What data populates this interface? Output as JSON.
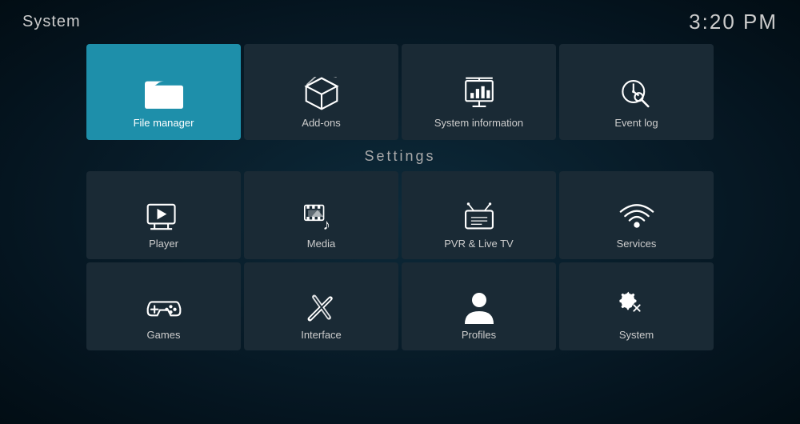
{
  "topBar": {
    "title": "System",
    "time": "3:20 PM"
  },
  "topTiles": [
    {
      "id": "file-manager",
      "label": "File manager",
      "active": true
    },
    {
      "id": "add-ons",
      "label": "Add-ons",
      "active": false
    },
    {
      "id": "system-information",
      "label": "System information",
      "active": false
    },
    {
      "id": "event-log",
      "label": "Event log",
      "active": false
    }
  ],
  "settingsLabel": "Settings",
  "settingsRow1": [
    {
      "id": "player",
      "label": "Player"
    },
    {
      "id": "media",
      "label": "Media"
    },
    {
      "id": "pvr-live-tv",
      "label": "PVR & Live TV"
    },
    {
      "id": "services",
      "label": "Services"
    }
  ],
  "settingsRow2": [
    {
      "id": "games",
      "label": "Games"
    },
    {
      "id": "interface",
      "label": "Interface"
    },
    {
      "id": "profiles",
      "label": "Profiles"
    },
    {
      "id": "system",
      "label": "System"
    }
  ]
}
